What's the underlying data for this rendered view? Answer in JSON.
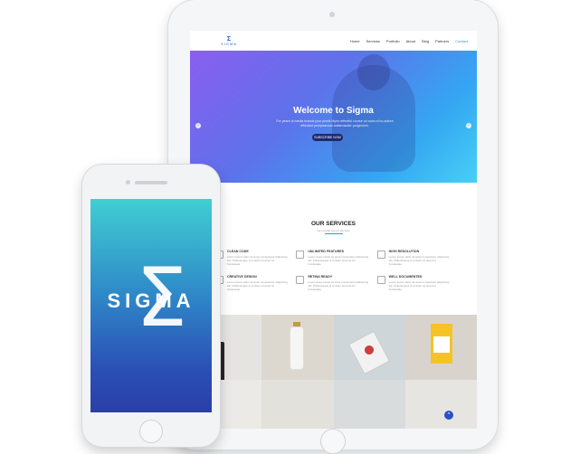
{
  "site": {
    "nav": [
      "Home",
      "Services",
      "Portfolio",
      "About",
      "Blog",
      "Partners",
      "Contact"
    ],
    "logo_text": "SIGMA",
    "hero": {
      "title": "Welcome to Sigma",
      "subtitle": "For years of media brands your pixels Myrto effectful course od autor.el bo autore effectant pemprtaciuto dollarmauter porgenium.",
      "button": "SUBSCRIBE NOW"
    },
    "services": {
      "title": "OUR SERVICES",
      "subtitle": "we provide best of the best",
      "items": [
        {
          "title": "CLEAN CODE",
          "text": "Lorem ipsum dolor sit amet consectetur adipiscing elit. Pellentesque is ut dolor sit amet for Incolesiate."
        },
        {
          "title": "UNLIMITED FEATURES",
          "text": "Lorem ipsum dolor sit amet consectetur adipiscing elit. Pellentesque is ut dolor sit amet for Incolesiate."
        },
        {
          "title": "HIGH RESOLUTION",
          "text": "Lorem ipsum dolor sit amet consectetur adipiscing elit. Pellentesque is ut dolor sit amet for Incolesiate."
        },
        {
          "title": "CREATIVE DESIGN",
          "text": "Lorem ipsum dolor sit amet consectetur adipiscing elit. Pellentesque is ut dolor sit amet for Incolesiate."
        },
        {
          "title": "RETINA READY",
          "text": "Lorem ipsum dolor sit amet consectetur adipiscing elit. Pellentesque is ut dolor sit amet for Incolesiate."
        },
        {
          "title": "WELL DOCUMENTED",
          "text": "Lorem ipsum dolor sit amet consectetur adipiscing elit. Pellentesque is ut dolor sit amet for Incolesiate."
        }
      ]
    }
  },
  "phone": {
    "brand": "SIGMA",
    "symbol": "Σ"
  },
  "colors": {
    "accent": "#2b9be8",
    "hero_start": "#8a5ef0",
    "hero_end": "#46d0f5",
    "phone_top": "#40cfd3",
    "phone_bottom": "#2a3fa8"
  }
}
